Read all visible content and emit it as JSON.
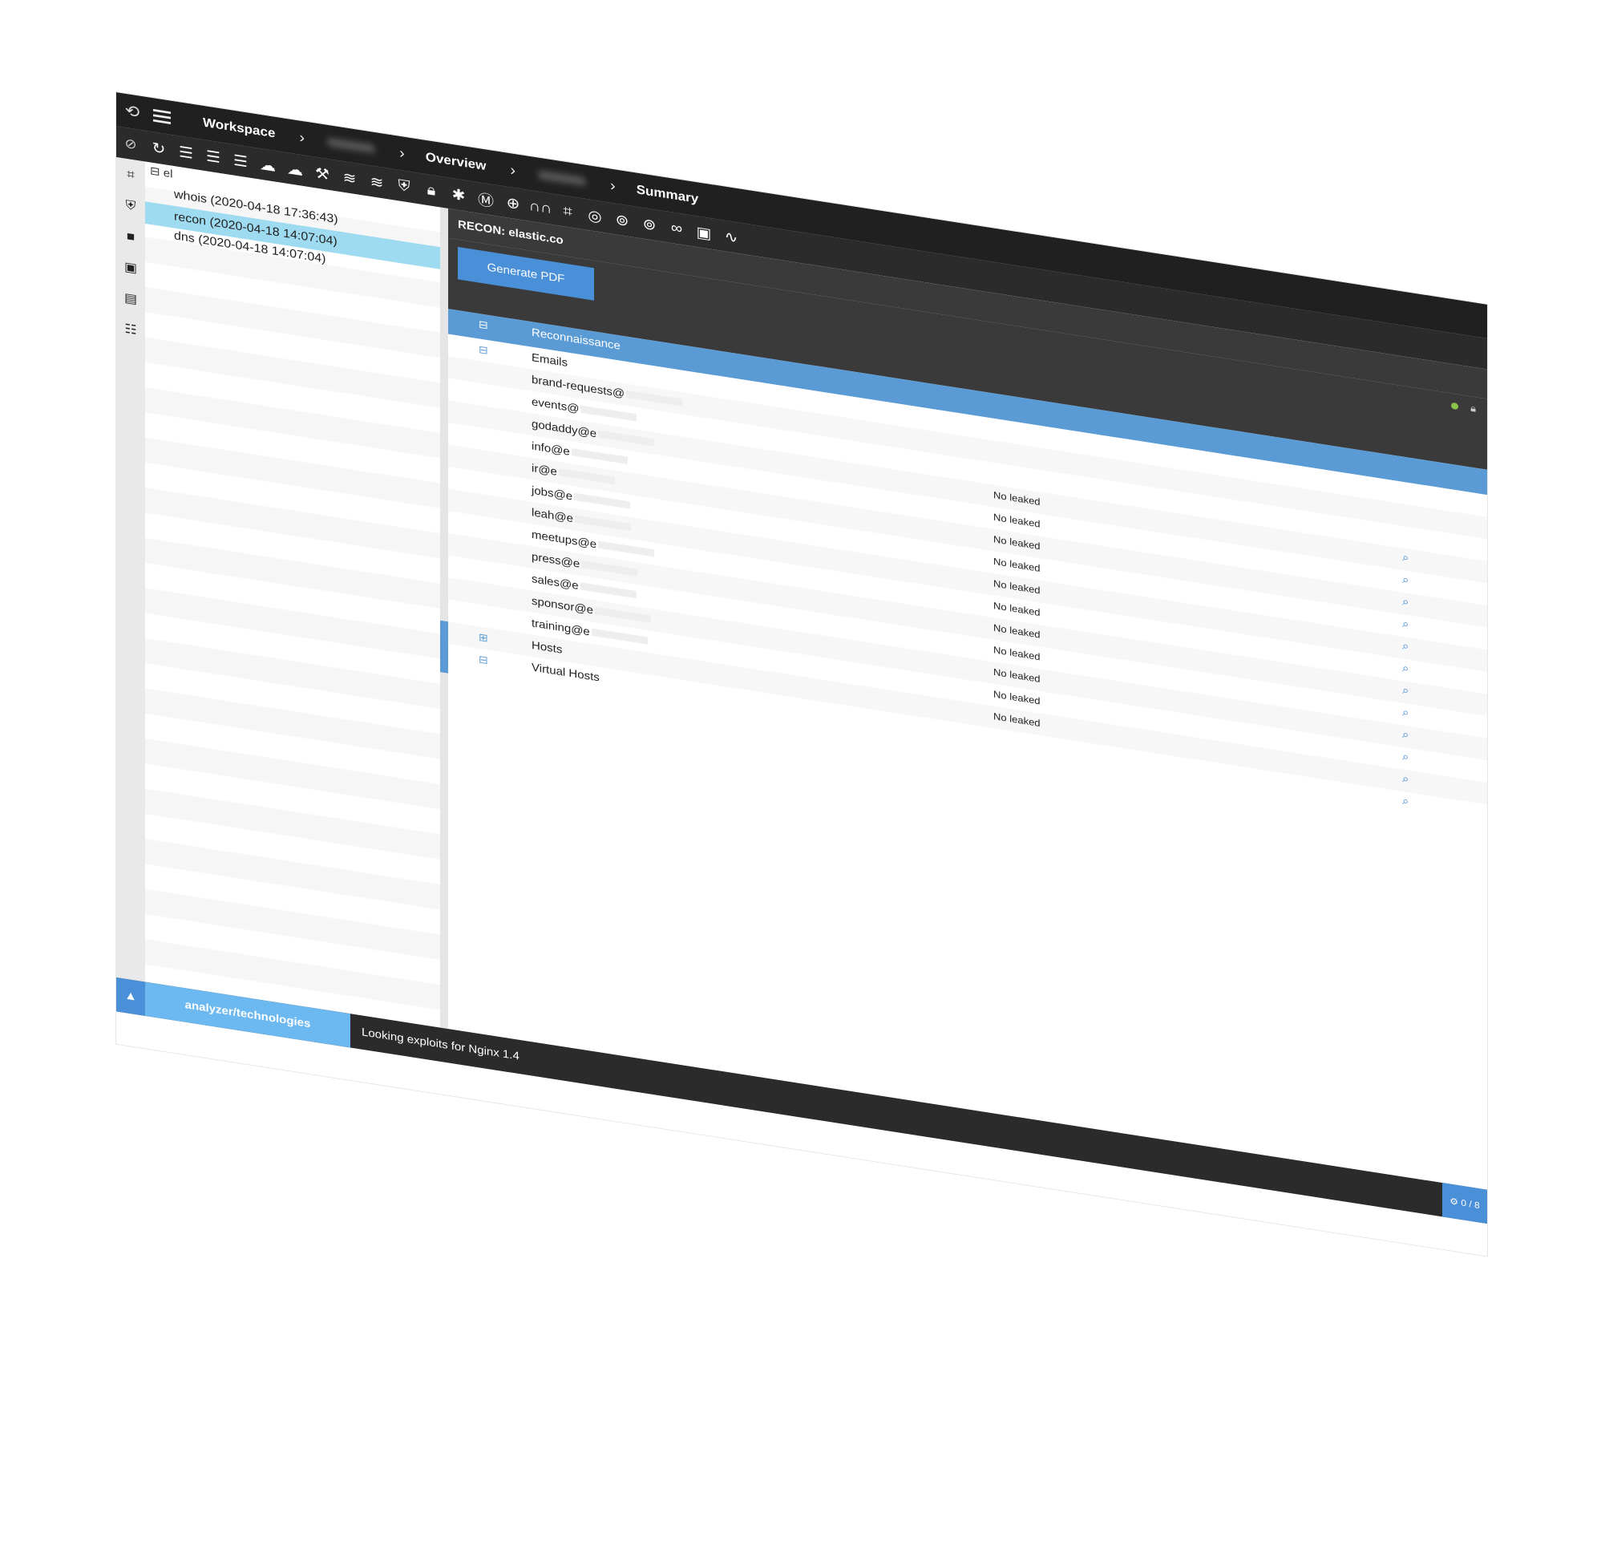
{
  "topbar": {
    "workspace": "Workspace",
    "overview": "Overview",
    "summary": "Summary"
  },
  "toolbar": {
    "icons": [
      "refresh-icon",
      "database-icon",
      "database-icon",
      "database-icon",
      "cloud-icon",
      "cloud-icon",
      "hammer-icon",
      "layers-icon",
      "layers-icon",
      "shield-icon",
      "lock-icon",
      "bug-icon",
      "shield-m-icon",
      "globe-icon",
      "binoculars-icon",
      "crop-icon",
      "dns-icon",
      "whois-search-icon",
      "rdap-search-icon",
      "link-icon",
      "inbox-icon",
      "pulse-icon"
    ]
  },
  "tree": {
    "root": "el",
    "items": [
      {
        "label": "whois (2020-04-18 17:36:43)",
        "selected": false
      },
      {
        "label": "recon (2020-04-18 14:07:04)",
        "selected": true
      },
      {
        "label": "dns (2020-04-18 14:07:04)",
        "selected": false
      }
    ]
  },
  "main": {
    "title": "RECON: elastic.co",
    "generate_pdf": "Generate PDF",
    "section": "Reconnaissance",
    "emails_group": "Emails",
    "emails": [
      {
        "name": "brand-requests@",
        "status": ""
      },
      {
        "name": "events@",
        "status": ""
      },
      {
        "name": "godaddy@e",
        "status": "No leaked"
      },
      {
        "name": "info@e",
        "status": "No leaked"
      },
      {
        "name": "ir@e",
        "status": "No leaked"
      },
      {
        "name": "jobs@e",
        "status": "No leaked"
      },
      {
        "name": "leah@e",
        "status": "No leaked"
      },
      {
        "name": "meetups@e",
        "status": "No leaked"
      },
      {
        "name": "press@e",
        "status": "No leaked"
      },
      {
        "name": "sales@e",
        "status": "No leaked"
      },
      {
        "name": "sponsor@e",
        "status": "No leaked"
      },
      {
        "name": "training@e",
        "status": "No leaked"
      }
    ],
    "hosts": "Hosts",
    "virtual_hosts": "Virtual Hosts",
    "host_status": "No leaked"
  },
  "footer": {
    "module": "analyzer/technologies",
    "message": "Looking exploits for Nginx 1.4",
    "counter": "0 / 8"
  }
}
